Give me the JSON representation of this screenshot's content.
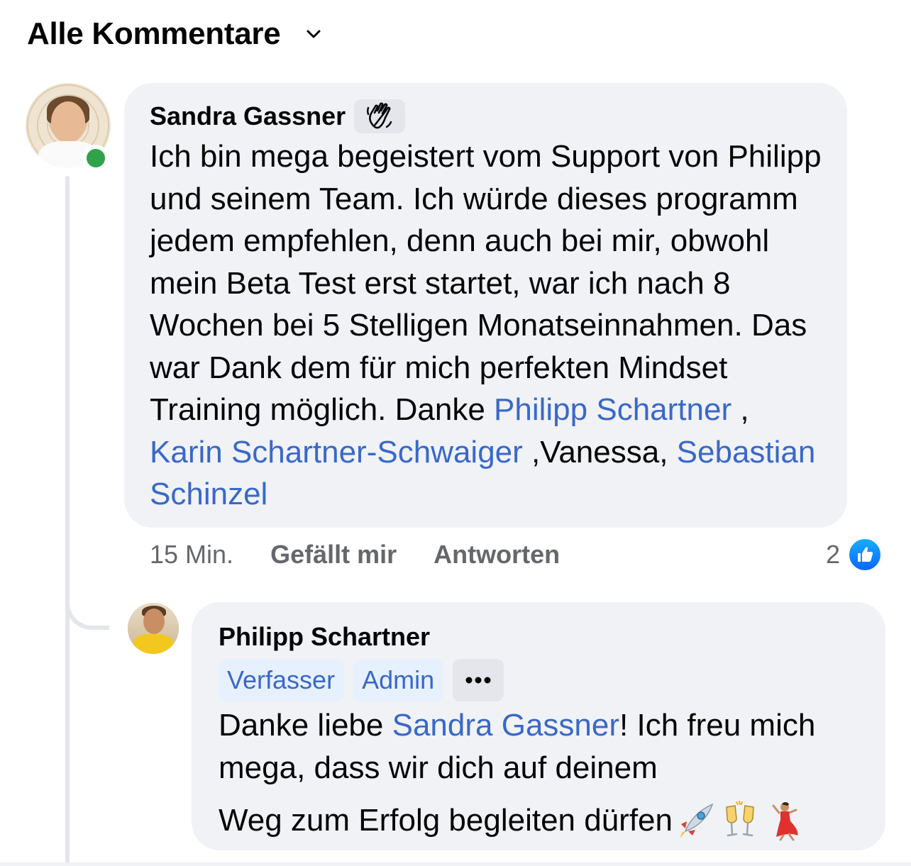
{
  "header": {
    "title": "Alle Kommentare"
  },
  "comment": {
    "author": "Sandra Gassner",
    "text": "Ich bin mega begeistert vom Support von Philipp und seinem Team. Ich würde dieses programm jedem empfehlen, denn auch bei mir, obwohl mein Beta Test erst startet, war ich nach 8 Wochen bei 5 Stelligen Monatseinnahmen. Das war Dank dem für mich perfekten Mindset Training möglich. Danke ",
    "mention1": "Philipp Schartner",
    "sep1": " , ",
    "mention2": "Karin Schartner-Schwaiger",
    "sep2": " ,Vanessa, ",
    "mention3": "Sebastian Schinzel",
    "time": "15 Min.",
    "like_label": "Gefällt mir",
    "reply_label": "Antworten",
    "reaction_count": "2"
  },
  "reply": {
    "author": "Philipp Schartner",
    "tags": [
      "Verfasser",
      "Admin"
    ],
    "text_before": "Danke liebe ",
    "mention": "Sandra Gassner",
    "text_after": "! Ich freu mich mega, dass wir dich auf deinem",
    "text_line3": "Weg zum Erfolg begleiten dürfen"
  },
  "colors": {
    "bubble": "#f0f2f5",
    "link": "#3a68c9",
    "online": "#31a24c",
    "like": "#0866ff"
  }
}
